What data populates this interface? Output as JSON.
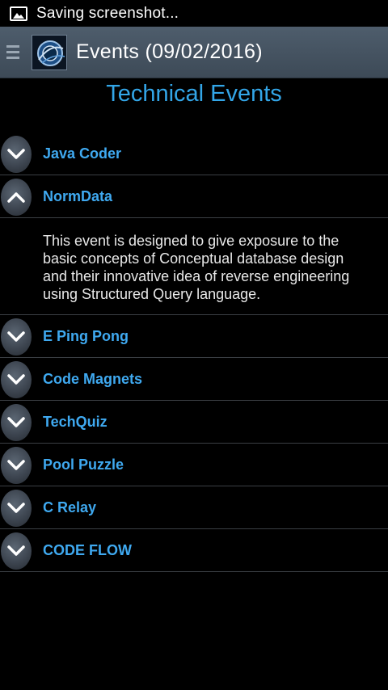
{
  "status_bar": {
    "text": "Saving screenshot...",
    "icon": "picture-icon"
  },
  "action_bar": {
    "title": "Events (09/02/2016)",
    "menu_icon": "hamburger-icon",
    "logo_icon": "app-logo-icon"
  },
  "page": {
    "heading": "Technical Events"
  },
  "events": [
    {
      "label": "Java Coder",
      "expanded": false
    },
    {
      "label": "NormData",
      "expanded": true,
      "description": "This event is designed to give exposure to the basic concepts of Conceptual database design and their innovative idea of reverse engineering using Structured Query language."
    },
    {
      "label": "E Ping Pong",
      "expanded": false
    },
    {
      "label": "Code Magnets",
      "expanded": false
    },
    {
      "label": "TechQuiz",
      "expanded": false
    },
    {
      "label": "Pool Puzzle",
      "expanded": false
    },
    {
      "label": "C Relay",
      "expanded": false
    },
    {
      "label": "CODE FLOW",
      "expanded": false
    }
  ],
  "colors": {
    "accent": "#33a6e8",
    "action_bar": "#46535f",
    "background": "#000000"
  }
}
